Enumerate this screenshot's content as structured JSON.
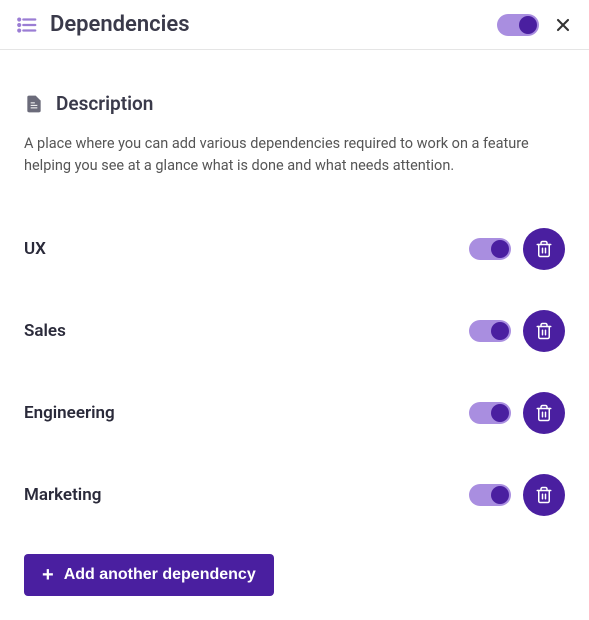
{
  "header": {
    "title": "Dependencies",
    "main_toggle_on": true
  },
  "section": {
    "title": "Description",
    "text": "A place where you can add various dependencies required to work on a feature helping you see at a glance what is done and what needs attention."
  },
  "dependencies": [
    {
      "label": "UX",
      "enabled": true
    },
    {
      "label": "Sales",
      "enabled": true
    },
    {
      "label": "Engineering",
      "enabled": true
    },
    {
      "label": "Marketing",
      "enabled": true
    }
  ],
  "actions": {
    "add_label": "Add another dependency"
  },
  "colors": {
    "accent": "#4a1fa0",
    "accent_light": "#a98ee0"
  }
}
